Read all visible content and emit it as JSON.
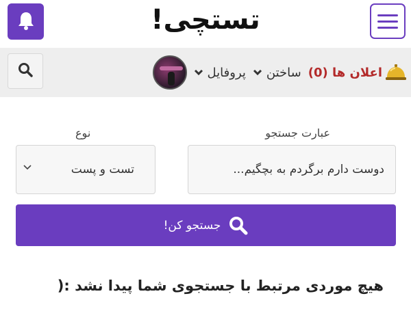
{
  "header": {
    "logo_text": "تستچی!",
    "notifications_icon": "bell-icon",
    "menu_icon": "hamburger-menu-icon"
  },
  "nav": {
    "profile_label": "پروفایل",
    "build_label": "ساختن",
    "notifications_label": "اعلان ها (0)",
    "search_icon": "search-icon"
  },
  "search": {
    "phrase_label": "عبارت جستجو",
    "phrase_value": "دوست دارم برگردم به بچگیم...",
    "type_label": "نوع",
    "type_value": "تست و پست",
    "submit_label": "جستجو کن!"
  },
  "results": {
    "empty_message": "هیچ موردی مرتبط با جستجوی شما پیدا نشد :("
  },
  "colors": {
    "brand": "#6a3dbf",
    "notification_text": "#b32a2a"
  }
}
